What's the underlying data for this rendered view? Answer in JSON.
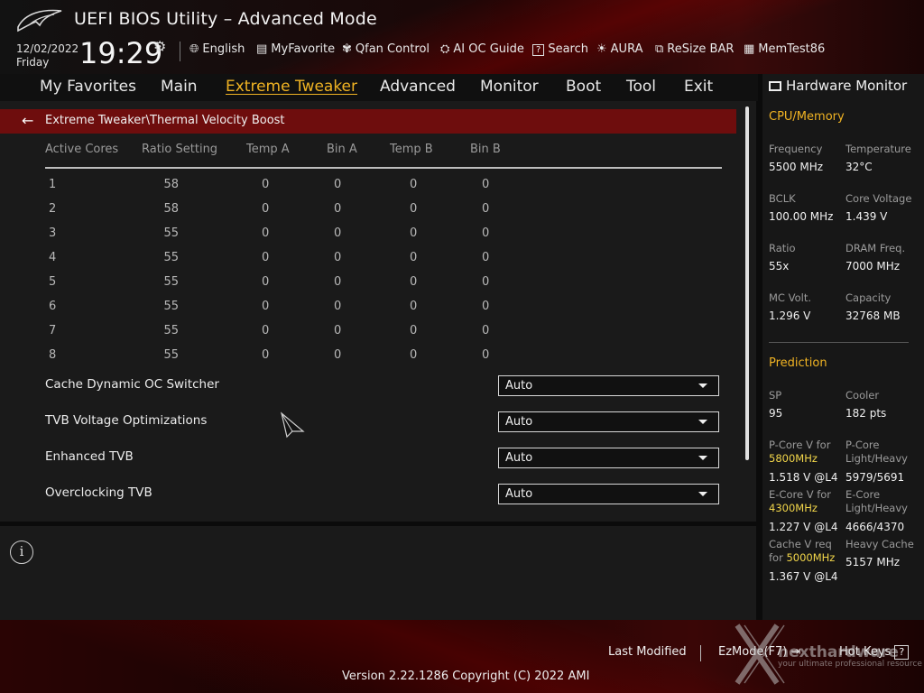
{
  "app": {
    "title": "UEFI BIOS Utility – Advanced Mode",
    "date": "12/02/2022",
    "day": "Friday",
    "time": "19:29"
  },
  "toolbar": [
    {
      "icon": "globe-icon",
      "label": "English"
    },
    {
      "icon": "favorite-icon",
      "label": "MyFavorite"
    },
    {
      "icon": "fan-icon",
      "label": "Qfan Control"
    },
    {
      "icon": "chip-icon",
      "label": "AI OC Guide"
    },
    {
      "icon": "search-icon",
      "label": "Search"
    },
    {
      "icon": "aura-icon",
      "label": "AURA"
    },
    {
      "icon": "resize-icon",
      "label": "ReSize BAR"
    },
    {
      "icon": "memory-icon",
      "label": "MemTest86"
    }
  ],
  "nav": {
    "tabs": [
      "My Favorites",
      "Main",
      "Extreme Tweaker",
      "Advanced",
      "Monitor",
      "Boot",
      "Tool",
      "Exit"
    ],
    "active": "Extreme Tweaker"
  },
  "breadcrumb": "Extreme Tweaker\\Thermal Velocity Boost",
  "table": {
    "headers": [
      "Active Cores",
      "Ratio Setting",
      "Temp A",
      "Bin A",
      "Temp B",
      "Bin B"
    ],
    "rows": [
      [
        "1",
        "58",
        "0",
        "0",
        "0",
        "0"
      ],
      [
        "2",
        "58",
        "0",
        "0",
        "0",
        "0"
      ],
      [
        "3",
        "55",
        "0",
        "0",
        "0",
        "0"
      ],
      [
        "4",
        "55",
        "0",
        "0",
        "0",
        "0"
      ],
      [
        "5",
        "55",
        "0",
        "0",
        "0",
        "0"
      ],
      [
        "6",
        "55",
        "0",
        "0",
        "0",
        "0"
      ],
      [
        "7",
        "55",
        "0",
        "0",
        "0",
        "0"
      ],
      [
        "8",
        "55",
        "0",
        "0",
        "0",
        "0"
      ]
    ]
  },
  "options": [
    {
      "label": "Cache Dynamic OC Switcher",
      "value": "Auto"
    },
    {
      "label": "TVB Voltage Optimizations",
      "value": "Auto"
    },
    {
      "label": "Enhanced TVB",
      "value": "Auto"
    },
    {
      "label": "Overclocking TVB",
      "value": "Auto"
    }
  ],
  "hw": {
    "title": "Hardware Monitor",
    "cpu_section": "CPU/Memory",
    "cpu": [
      {
        "label": "Frequency",
        "value": "5500 MHz"
      },
      {
        "label": "Temperature",
        "value": "32°C"
      },
      {
        "label": "BCLK",
        "value": "100.00 MHz"
      },
      {
        "label": "Core Voltage",
        "value": "1.439 V"
      },
      {
        "label": "Ratio",
        "value": "55x"
      },
      {
        "label": "DRAM Freq.",
        "value": "7000 MHz"
      },
      {
        "label": "MC Volt.",
        "value": "1.296 V"
      },
      {
        "label": "Capacity",
        "value": "32768 MB"
      }
    ],
    "pred_section": "Prediction",
    "sp_label": "SP",
    "sp_value": "95",
    "cooler_label": "Cooler",
    "cooler_value": "182 pts",
    "pcore_label": "P-Core V for",
    "pcore_freq": "5800MHz",
    "pcore_value": "1.518 V @L4",
    "pcore_lh_label_1": "P-Core",
    "pcore_lh_label_2": "Light/Heavy",
    "pcore_lh_value": "5979/5691",
    "ecore_label": "E-Core V for",
    "ecore_freq": "4300MHz",
    "ecore_value": "1.227 V @L4",
    "ecore_lh_label_1": "E-Core",
    "ecore_lh_label_2": "Light/Heavy",
    "ecore_lh_value": "4666/4370",
    "cache_label_1": "Cache V req",
    "cache_label_2": "for",
    "cache_freq": "5000MHz",
    "cache_value": "1.367 V @L4",
    "hcache_label": "Heavy Cache",
    "hcache_value": "5157 MHz"
  },
  "footer": {
    "last_modified": "Last Modified",
    "ezmode": "EzMode(F7)",
    "hotkeys": "Hot Keys",
    "hotkeys_key": "?",
    "version": "Version 2.22.1286 Copyright (C) 2022 AMI",
    "watermark": "nexthardware",
    "watermark_sub": "your ultimate professional resource"
  },
  "colors": {
    "accent": "#f0b323",
    "breadcrumb_bg": "#6e0d0d",
    "highlight": "#f2d64a"
  }
}
